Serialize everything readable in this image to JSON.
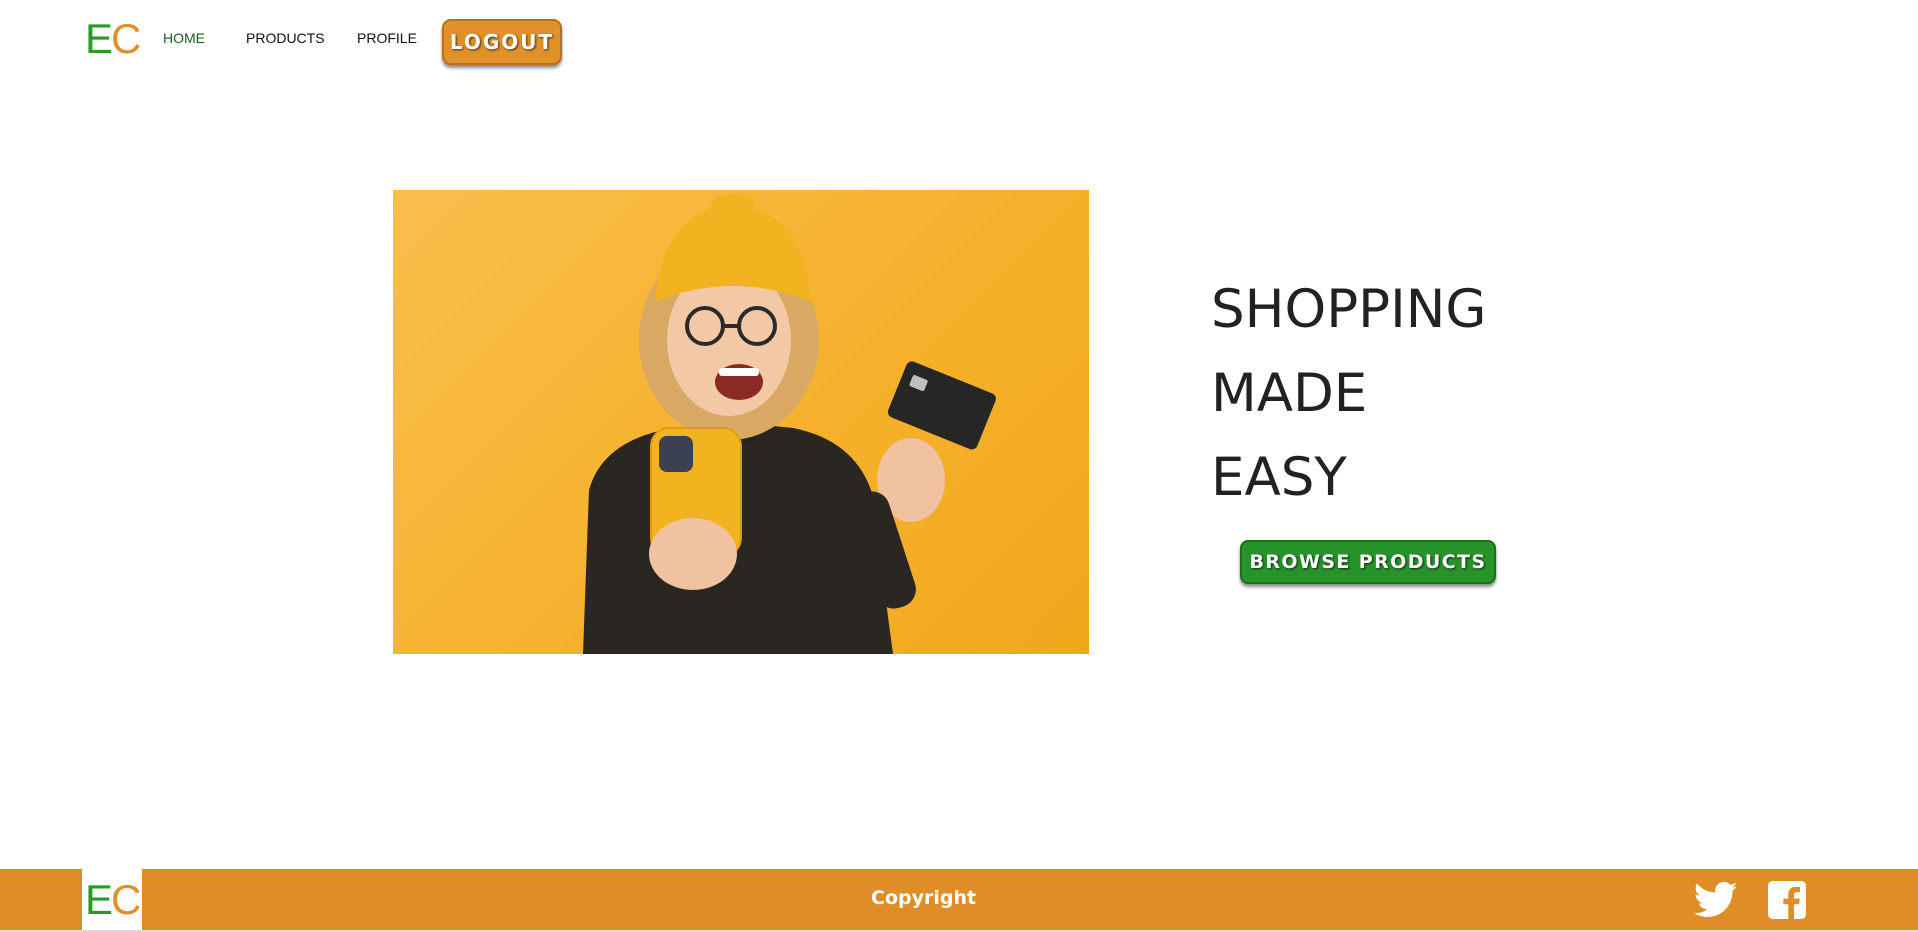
{
  "brand": {
    "logo_e": "E",
    "logo_c": "C",
    "primary_green": "#2a9a26",
    "primary_orange": "#e08f29"
  },
  "header": {
    "nav": {
      "home": "HOME",
      "products": "PRODUCTS",
      "profile": "PROFILE"
    },
    "logout_label": "LOGOUT"
  },
  "hero": {
    "image_icon": "woman-shopping-phone-card-photo",
    "title_lines": [
      "SHOPPING",
      "MADE",
      "EASY"
    ],
    "browse_label": "BROWSE PRODUCTS"
  },
  "footer": {
    "copyright": "Copyright",
    "icons": [
      "twitter-icon",
      "facebook-icon"
    ],
    "background": "#df8d28"
  }
}
